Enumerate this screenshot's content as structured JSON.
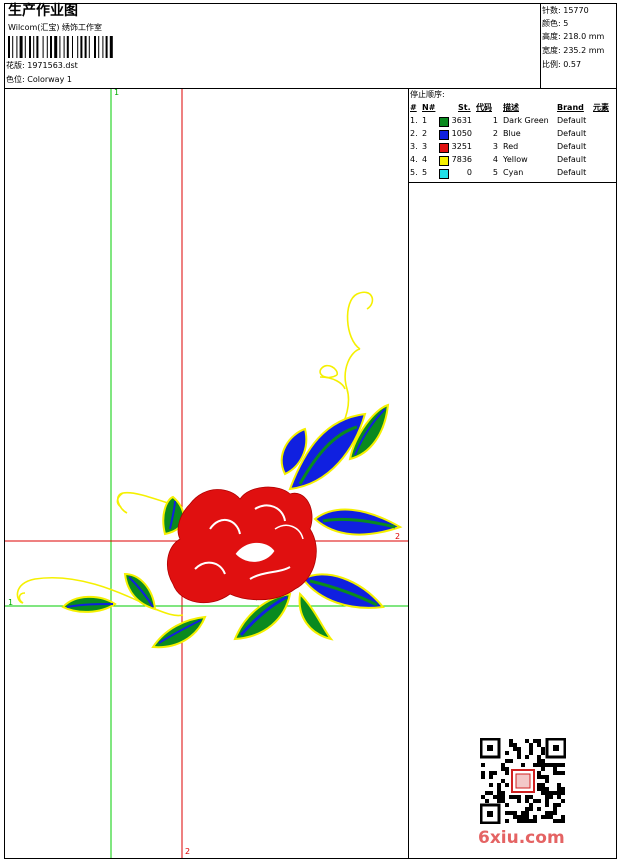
{
  "header": {
    "title": "生产作业图",
    "company": "Wilcom(汇宝) 绣饰工作室",
    "pattern_label": "花版:",
    "pattern_value": "1971563.dst",
    "colorway_label": "色位:",
    "colorway_value": "Colorway 1"
  },
  "stats": [
    {
      "label": "针数:",
      "value": "15770"
    },
    {
      "label": "颜色:",
      "value": "5"
    },
    {
      "label": "高度:",
      "value": "218.0 mm"
    },
    {
      "label": "宽度:",
      "value": "235.2 mm"
    },
    {
      "label": "比例:",
      "value": "0.57"
    }
  ],
  "stop_table": {
    "title": "停止顺序:",
    "headers": [
      "#",
      "N#",
      "St.",
      "代码",
      "描述",
      "Brand",
      "元素"
    ],
    "rows": [
      {
        "idx": "1.",
        "n": "1",
        "color": "#0a8a1f",
        "st": "3631",
        "code": "1",
        "desc": "Dark Green",
        "brand": "Default"
      },
      {
        "idx": "2.",
        "n": "2",
        "color": "#1020e0",
        "st": "1050",
        "code": "2",
        "desc": "Blue",
        "brand": "Default"
      },
      {
        "idx": "3.",
        "n": "3",
        "color": "#e01010",
        "st": "3251",
        "code": "3",
        "desc": "Red",
        "brand": "Default"
      },
      {
        "idx": "4.",
        "n": "4",
        "color": "#f5f000",
        "st": "7836",
        "code": "4",
        "desc": "Yellow",
        "brand": "Default"
      },
      {
        "idx": "5.",
        "n": "5",
        "color": "#22e0e8",
        "st": "0",
        "code": "5",
        "desc": "Cyan",
        "brand": "Default"
      }
    ]
  },
  "guides": {
    "green_top": "1",
    "green_left": "1",
    "red_right": "2",
    "red_bottom": "2"
  },
  "watermark": "6xiu.com",
  "colors": {
    "dark_green": "#0a8a1f",
    "blue": "#1020e0",
    "red": "#e01010",
    "yellow": "#f5f000",
    "guide_green": "#00cc00",
    "guide_red": "#dd0000"
  }
}
